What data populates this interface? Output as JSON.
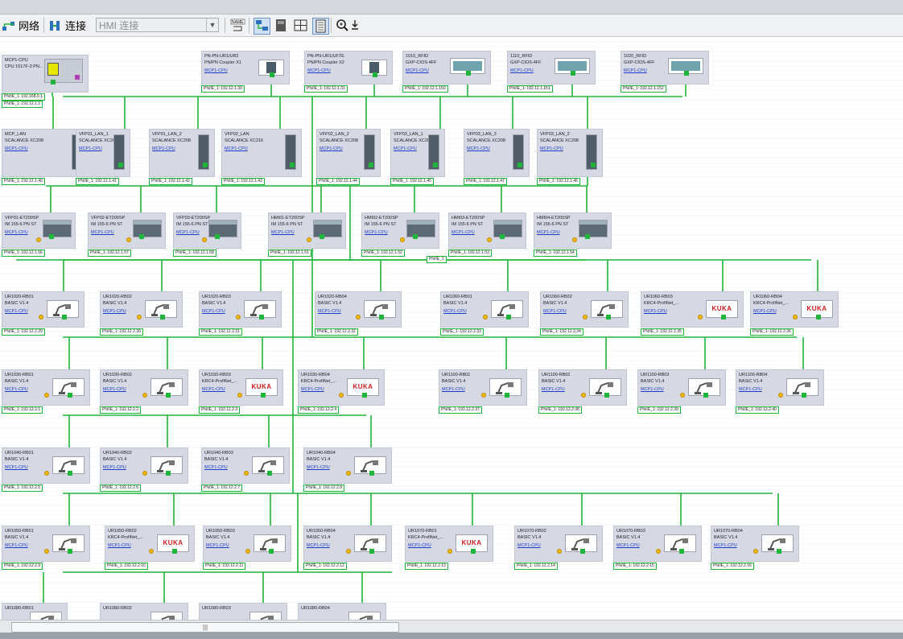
{
  "toolbar": {
    "network_label": "网络",
    "connections_label": "连接",
    "hmi_select_value": "HMI 连接"
  },
  "network": {
    "label": "PN/IE_1",
    "color": "#1fb53a"
  },
  "devices": [
    {
      "name": "MCP1-CPU",
      "type": "CPU 1517F-3 PN...",
      "link": "",
      "kind": "cpu",
      "ips": [
        "PN/IE_1: 192.168.0.1",
        "PN/IE_1: 192.12.1.1"
      ]
    },
    {
      "name": "PN-PN-UR1/UR2",
      "type": "PN/PN Coupler X1",
      "link": "MCP1-CPU",
      "kind": "coupler",
      "ips": [
        "PN/IE_1: 192.12.1.30"
      ]
    },
    {
      "name": "PN-PN-UR1/UFTE",
      "type": "PN/PN Coupler X2",
      "link": "MCP1-CPU",
      "kind": "coupler",
      "ips": [
        "PN/IE_1: 192.12.1.31"
      ]
    },
    {
      "name": "1010_RFID",
      "type": "GXP-CIOS-4FF",
      "link": "MCP1-CPU",
      "kind": "rfid",
      "ips": [
        "PN/IE_1: 192.12.1.150"
      ]
    },
    {
      "name": "1110_RFID",
      "type": "GXP-CIOS-4FF",
      "link": "MCP1-CPU",
      "kind": "rfid",
      "ips": [
        "PN/IE_1: 192.12.1.151"
      ]
    },
    {
      "name": "1020_RFID",
      "type": "GXP-CIOS-4FF",
      "link": "MCP1-CPU",
      "kind": "rfid",
      "ips": [
        "PN/IE_1: 192.12.1.152"
      ]
    },
    {
      "name": "MCP_LAN",
      "type": "SCALANCE XC208",
      "link": "MCP1-CPU",
      "kind": "switch",
      "ips": [
        "PN/IE_1: 192.12.1.40"
      ]
    },
    {
      "name": "VFP01_LAN_1",
      "type": "SCALANCE XC208",
      "link": "MCP1-CPU",
      "kind": "switch",
      "ips": [
        "PN/IE_1: 192.12.1.41"
      ]
    },
    {
      "name": "VFP01_LAN_2",
      "type": "SCALANCE XC208",
      "link": "MCP1-CPU",
      "kind": "switch",
      "ips": [
        "PN/IE_1: 192.12.1.42"
      ]
    },
    {
      "name": "VFP02_LAN",
      "type": "SCALANCE XC216",
      "link": "MCP1-CPU",
      "kind": "switch-wide",
      "ips": [
        "PN/IE_1: 192.12.1.43"
      ]
    },
    {
      "name": "VFP02_LAN_2",
      "type": "SCALANCE XC208",
      "link": "MCP1-CPU",
      "kind": "switch",
      "ips": [
        "PN/IE_1: 192.12.1.44"
      ]
    },
    {
      "name": "VFP03_LAN_1",
      "type": "SCALANCE XC208",
      "link": "MCP1-CPU",
      "kind": "switch",
      "ips": [
        "PN/IE_1: 192.12.1.45"
      ]
    },
    {
      "name": "VFP03_LAN_3",
      "type": "SCALANCE XC208",
      "link": "MCP1-CPU",
      "kind": "switch",
      "ips": [
        "PN/IE_1: 192.12.1.47"
      ]
    },
    {
      "name": "VFP03_LAN_2",
      "type": "SCALANCE XC208",
      "link": "MCP1-CPU",
      "kind": "switch",
      "ips": [
        "PN/IE_1: 192.12.1.46"
      ]
    },
    {
      "name": "VFP01-ET200SP",
      "type": "IM 155-6 PN ST",
      "link": "MCP1-CPU",
      "kind": "et200",
      "ips": [
        "PN/IE_1: 192.12.1.56"
      ]
    },
    {
      "name": "VFP02-ET200SP",
      "type": "IM 155-6 PN ST",
      "link": "MCP1-CPU",
      "kind": "et200",
      "ips": [
        "PN/IE_1: 192.12.1.57"
      ]
    },
    {
      "name": "VFP03-ET200SP",
      "type": "IM 155-6 PN ST",
      "link": "MCP1-CPU",
      "kind": "et200",
      "ips": [
        "PN/IE_1: 192.12.1.58"
      ]
    },
    {
      "name": "HMI01-ET200SP",
      "type": "IM 155-6 PN ST",
      "link": "MCP1-CPU",
      "kind": "et200",
      "ips": [
        "PN/IE_1: 192.12.1.51"
      ]
    },
    {
      "name": "HMI02-ET200SP",
      "type": "IM 155-6 PN ST",
      "link": "MCP1-CPU",
      "kind": "et200",
      "ips": [
        "PN/IE_1: 192.12.1.52"
      ]
    },
    {
      "name": "HMI03-ET200SP",
      "type": "IM 155-6 PN ST",
      "link": "MCP1-CPU",
      "kind": "et200",
      "ips": [
        "PN/IE_1: 192.12.1.53"
      ]
    },
    {
      "name": "HMI04-ET200SP",
      "type": "IM 155-6 PN ST",
      "link": "MCP1-CPU",
      "kind": "et200",
      "ips": [
        "PN/IE_1: 192.12.1.54"
      ]
    },
    {
      "name": "UR1020-RB01",
      "type": "BASIC V1.4",
      "link": "MCP1-CPU",
      "kind": "robot",
      "ips": [
        "PN/IE_1: 192.12.2.29"
      ]
    },
    {
      "name": "UR1020-RB02",
      "type": "BASIC V1.4",
      "link": "MCP1-CPU",
      "kind": "robot",
      "ips": [
        "PN/IE_1: 192.12.2.30"
      ]
    },
    {
      "name": "UR1020-RB03",
      "type": "BASIC V1.4",
      "link": "MCP1-CPU",
      "kind": "robot",
      "ips": [
        "PN/IE_1: 192.12.2.31"
      ]
    },
    {
      "name": "UR1020-RB04",
      "type": "BASIC V1.4",
      "link": "MCP1-CPU",
      "kind": "robot",
      "ips": [
        "PN/IE_1: 192.12.2.32"
      ]
    },
    {
      "name": "UR1060-RB01",
      "type": "BASIC V1.4",
      "link": "MCP1-CPU",
      "kind": "robot",
      "ips": [
        "PN/IE_1: 192.12.2.33"
      ]
    },
    {
      "name": "UR1060-RB02",
      "type": "BASIC V1.4",
      "link": "MCP1-CPU",
      "kind": "robot",
      "ips": [
        "PN/IE_1: 192.12.2.34"
      ]
    },
    {
      "name": "UR1060-RB03",
      "type": "KRC4-ProfiNet_...",
      "link": "MCP1-CPU",
      "kind": "kuka",
      "ips": [
        "PN/IE_1: 192.12.2.35"
      ]
    },
    {
      "name": "UR1060-RB04",
      "type": "KRC4-ProfiNet_...",
      "link": "MCP1-CPU",
      "kind": "kuka",
      "ips": [
        "PN/IE_1: 192.12.2.36"
      ]
    },
    {
      "name": "UR1030-RB01",
      "type": "BASIC V1.4",
      "link": "MCP1-CPU",
      "kind": "robot",
      "ips": [
        "PN/IE_1: 192.12.2.1"
      ]
    },
    {
      "name": "UR1030-RB02",
      "type": "BASIC V1.4",
      "link": "MCP1-CPU",
      "kind": "robot",
      "ips": [
        "PN/IE_1: 192.12.2.2"
      ]
    },
    {
      "name": "UR1030-RB03",
      "type": "KRC4-ProfiNet_...",
      "link": "MCP1-CPU",
      "kind": "kuka",
      "ips": [
        "PN/IE_1: 192.12.2.3"
      ]
    },
    {
      "name": "UR1030-RB04",
      "type": "KRC4-ProfiNet_...",
      "link": "MCP1-CPU",
      "kind": "kuka",
      "ips": [
        "PN/IE_1: 192.12.2.4"
      ]
    },
    {
      "name": "UR1100-RB01",
      "type": "BASIC V1.4",
      "link": "MCP1-CPU",
      "kind": "robot",
      "ips": [
        "PN/IE_1: 192.12.2.37"
      ]
    },
    {
      "name": "UR1100-RB02",
      "type": "BASIC V1.4",
      "link": "MCP1-CPU",
      "kind": "robot",
      "ips": [
        "PN/IE_1: 192.12.2.38"
      ]
    },
    {
      "name": "UR1100-RB03",
      "type": "BASIC V1.4",
      "link": "MCP1-CPU",
      "kind": "robot",
      "ips": [
        "PN/IE_1: 192.12.2.39"
      ]
    },
    {
      "name": "UR1100-RB04",
      "type": "BASIC V1.4",
      "link": "MCP1-CPU",
      "kind": "robot",
      "ips": [
        "PN/IE_1: 192.12.2.40"
      ]
    },
    {
      "name": "UR1040-RB01",
      "type": "BASIC V1.4",
      "link": "MCP1-CPU",
      "kind": "robot",
      "ips": [
        "PN/IE_1: 192.12.2.5"
      ]
    },
    {
      "name": "UR1040-RB02",
      "type": "BASIC V1.4",
      "link": "MCP1-CPU",
      "kind": "robot",
      "ips": [
        "PN/IE_1: 192.12.2.6"
      ]
    },
    {
      "name": "UR1040-RB03",
      "type": "BASIC V1.4",
      "link": "MCP1-CPU",
      "kind": "robot",
      "ips": [
        "PN/IE_1: 192.12.2.7"
      ]
    },
    {
      "name": "UR1040-RB04",
      "type": "BASIC V1.4",
      "link": "MCP1-CPU",
      "kind": "robot",
      "ips": [
        "PN/IE_1: 192.12.2.8"
      ]
    },
    {
      "name": "UR1050-RB01",
      "type": "BASIC V1.4",
      "link": "MCP1-CPU",
      "kind": "robot",
      "ips": [
        "PN/IE_1: 192.12.2.9"
      ]
    },
    {
      "name": "UR1050-RB02",
      "type": "KRC4-ProfiNet_...",
      "link": "MCP1-CPU",
      "kind": "kuka",
      "ips": [
        "PN/IE_1: 192.12.2.10"
      ]
    },
    {
      "name": "UR1050-RB03",
      "type": "BASIC V1.4",
      "link": "MCP1-CPU",
      "kind": "robot",
      "ips": [
        "PN/IE_1: 192.12.2.11"
      ]
    },
    {
      "name": "UR1050-RB04",
      "type": "BASIC V1.4",
      "link": "MCP1-CPU",
      "kind": "robot",
      "ips": [
        "PN/IE_1: 192.12.2.12"
      ]
    },
    {
      "name": "UR1070-RB01",
      "type": "KRC4-ProfiNet_...",
      "link": "MCP1-CPU",
      "kind": "kuka",
      "ips": [
        "PN/IE_1: 192.12.2.13"
      ]
    },
    {
      "name": "UR1070-RB02",
      "type": "BASIC V1.4",
      "link": "MCP1-CPU",
      "kind": "robot",
      "ips": [
        "PN/IE_1: 192.12.2.14"
      ]
    },
    {
      "name": "UR1070-RB03",
      "type": "BASIC V1.4",
      "link": "MCP1-CPU",
      "kind": "robot",
      "ips": [
        "PN/IE_1: 192.12.2.15"
      ]
    },
    {
      "name": "UR1070-RB04",
      "type": "BASIC V1.4",
      "link": "MCP1-CPU",
      "kind": "robot",
      "ips": [
        "PN/IE_1: 192.12.2.16"
      ]
    },
    {
      "name": "UR1080-RB01",
      "type": "",
      "link": "",
      "kind": "robot",
      "ips": []
    },
    {
      "name": "UR1080-RB02",
      "type": "",
      "link": "",
      "kind": "robot",
      "ips": []
    },
    {
      "name": "UR1080-RB03",
      "type": "",
      "link": "",
      "kind": "robot",
      "ips": []
    },
    {
      "name": "UR1080-RB04",
      "type": "",
      "link": "",
      "kind": "robot",
      "ips": []
    }
  ],
  "kuka_logo": "KUKA"
}
